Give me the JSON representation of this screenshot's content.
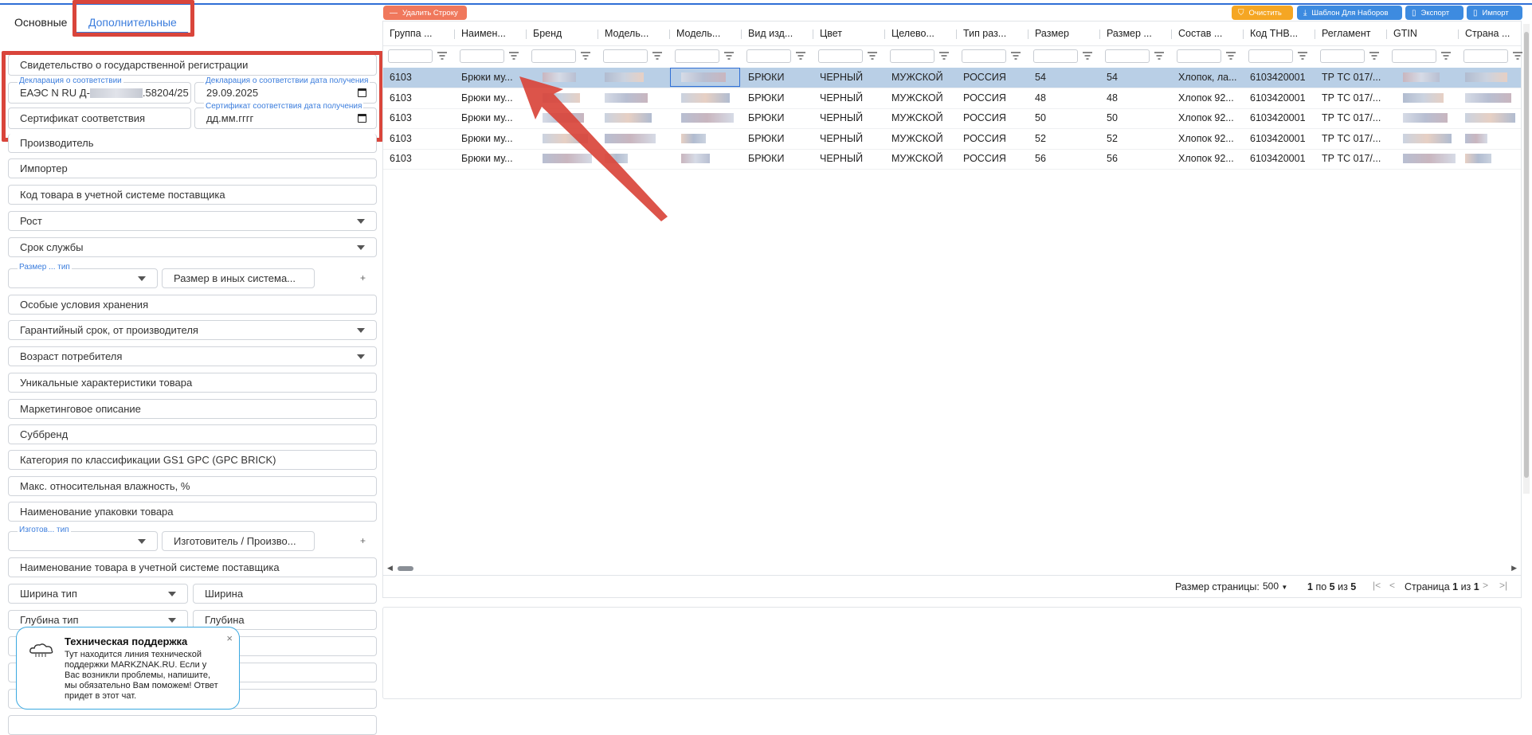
{
  "tabs": [
    {
      "label": "Основные"
    },
    {
      "label": "Дополнительные"
    }
  ],
  "left_fields": {
    "state_reg": "Свидетельство о государственной регистрации",
    "declaration_label": "Декларация о соответствии",
    "declaration_value_prefix": "ЕАЭС N RU Д-",
    "declaration_value_suffix": ".58204/25",
    "declaration_date_label": "Декларация о соответствии дата получения",
    "declaration_date_value": "29.09.2025",
    "certificate": "Сертификат соответствия",
    "certificate_date_label": "Сертификат соответствия дата получения",
    "certificate_date_placeholder": "дд.мм.гггг",
    "manufacturer": "Производитель",
    "importer": "Импортер",
    "supplier_code": "Код товара в учетной системе поставщика",
    "height": "Рост",
    "service_life": "Срок службы",
    "size_type_label": "Размер ... тип",
    "size_other": "Размер в иных система...",
    "storage": "Особые условия хранения",
    "warranty": "Гарантийный срок, от производителя",
    "consumer_age": "Возраст потребителя",
    "unique_chars": "Уникальные характеристики товара",
    "marketing": "Маркетинговое описание",
    "subbrand": "Суббренд",
    "gs1": "Категория по классификации GS1 GPC (GPC BRICK)",
    "humidity": "Макс. относительная влажность, %",
    "package_name": "Наименование упаковки товара",
    "maker_type_label": "Изготов... тип",
    "maker": "Изготовитель / Произво...",
    "supplier_name": "Наименование товара в учетной системе поставщика",
    "width_type": "Ширина тип",
    "width": "Ширина",
    "depth_type": "Глубина тип",
    "depth": "Глубина",
    "plus": "+"
  },
  "chat": {
    "title": "Техническая поддержка",
    "text": "Тут находится линия технической поддержки MARKZNAK.RU. Если у Вас возникли проблемы, напишите, мы обязательно Вам поможем! Ответ придет в этот чат.",
    "close": "×"
  },
  "toolbar": {
    "delete_row": "Удалить Строку",
    "clear": "Очистить",
    "template": "Шаблон Для Наборов",
    "export": "Экспорт",
    "import": "Импорт"
  },
  "grid": {
    "columns": [
      "Группа ...",
      "Наимен...",
      "Бренд",
      "Модель...",
      "Модель...",
      "Вид изд...",
      "Цвет",
      "Целево...",
      "Тип раз...",
      "Размер",
      "Размер ...",
      "Состав ...",
      "Код ТНВ...",
      "Регламент",
      "GTIN",
      "Страна ..."
    ],
    "rows": [
      [
        "6103",
        "Брюки му...",
        "",
        "",
        "",
        "БРЮКИ",
        "ЧЕРНЫЙ",
        "МУЖСКОЙ",
        "РОССИЯ",
        "54",
        "54",
        "Хлопок, ла...",
        "6103420001",
        "ТР ТС 017/...",
        "",
        ""
      ],
      [
        "6103",
        "Брюки му...",
        "",
        "",
        "",
        "БРЮКИ",
        "ЧЕРНЫЙ",
        "МУЖСКОЙ",
        "РОССИЯ",
        "48",
        "48",
        "Хлопок 92...",
        "6103420001",
        "ТР ТС 017/...",
        "",
        ""
      ],
      [
        "6103",
        "Брюки му...",
        "",
        "",
        "",
        "БРЮКИ",
        "ЧЕРНЫЙ",
        "МУЖСКОЙ",
        "РОССИЯ",
        "50",
        "50",
        "Хлопок 92...",
        "6103420001",
        "ТР ТС 017/...",
        "",
        ""
      ],
      [
        "6103",
        "Брюки му...",
        "",
        "",
        "",
        "БРЮКИ",
        "ЧЕРНЫЙ",
        "МУЖСКОЙ",
        "РОССИЯ",
        "52",
        "52",
        "Хлопок 92...",
        "6103420001",
        "ТР ТС 017/...",
        "",
        ""
      ],
      [
        "6103",
        "Брюки му...",
        "",
        "",
        "",
        "БРЮКИ",
        "ЧЕРНЫЙ",
        "МУЖСКОЙ",
        "РОССИЯ",
        "56",
        "56",
        "Хлопок 92...",
        "6103420001",
        "ТР ТС 017/...",
        "",
        ""
      ]
    ],
    "selected_row": 0
  },
  "pagination": {
    "page_size_label": "Размер страницы:",
    "page_size": "500",
    "range_from": "1",
    "range_to": "5",
    "total": "5",
    "word_to": "по",
    "word_of": "из",
    "page_word": "Страница",
    "page": "1",
    "page_of": "из",
    "page_total": "1"
  },
  "colors": {
    "accent": "#3b7ddd",
    "highlight": "#d9453b",
    "delete_btn": "#f0785c",
    "clear_btn": "#f5a623",
    "blue_btn": "#3d8be0",
    "selected_row": "#b9cfe6"
  }
}
